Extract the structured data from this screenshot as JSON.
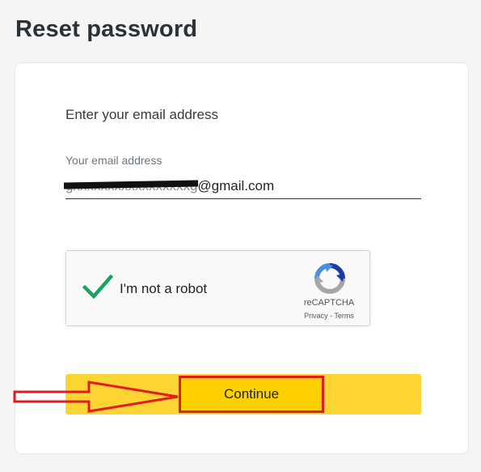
{
  "page": {
    "title": "Reset password"
  },
  "form": {
    "instruction": "Enter your email address",
    "email_label": "Your email address",
    "email_redacted_part": "gxxxxxxxxxxxxxxxxxg",
    "email_domain_part": "@gmail.com"
  },
  "captcha": {
    "label": "I'm not a robot",
    "brand": "reCAPTCHA",
    "privacy_link": "Privacy",
    "separator": " - ",
    "terms_link": "Terms",
    "checked": true
  },
  "actions": {
    "continue_label": "Continue"
  },
  "colors": {
    "accent_yellow": "#fcd535",
    "annotation_red": "#e41b1b",
    "check_green": "#1aa260"
  },
  "icons": {
    "checkmark": "check-icon",
    "recaptcha": "recaptcha-logo-icon",
    "annotation_arrow": "arrow-right-icon"
  }
}
